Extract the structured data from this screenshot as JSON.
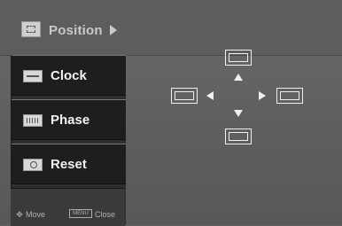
{
  "header": {
    "title": "Position",
    "icon": "position-icon",
    "arrow_icon": "right-arrow-icon"
  },
  "menu": {
    "items": [
      {
        "label": "Clock",
        "icon": "clock-icon"
      },
      {
        "label": "Phase",
        "icon": "phase-icon"
      },
      {
        "label": "Reset",
        "icon": "reset-icon"
      }
    ]
  },
  "footer": {
    "move_label": "Move",
    "menu_key_label": "MENU",
    "close_label": "Close"
  },
  "position_pad": {
    "icons": [
      "position-up-icon",
      "position-down-icon",
      "position-left-icon",
      "position-right-icon"
    ]
  },
  "colors": {
    "background": "#5f5f5f",
    "menu_item": "#1e1e1e",
    "text": "#f2f2f2",
    "header_text": "#c9c9c9"
  }
}
